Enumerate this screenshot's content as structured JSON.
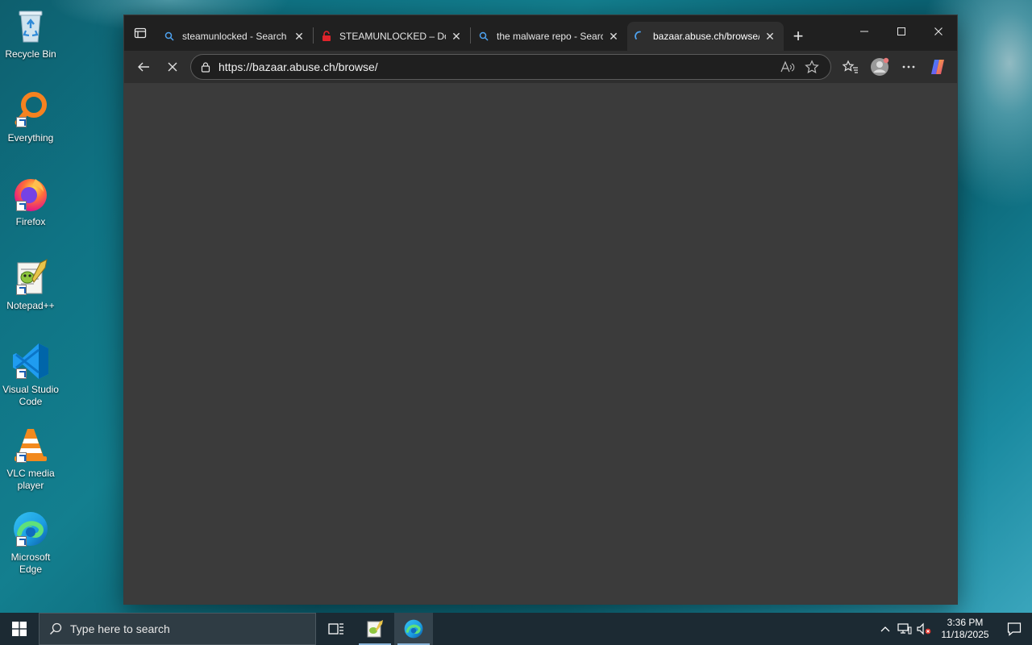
{
  "desktop": {
    "icons": [
      {
        "label": "Recycle Bin",
        "icon": "recycle-bin-icon"
      },
      {
        "label": "Everything",
        "icon": "everything-search-icon"
      },
      {
        "label": "Firefox",
        "icon": "firefox-icon"
      },
      {
        "label": "Notepad++",
        "icon": "notepadpp-icon"
      },
      {
        "label": "Visual Studio Code",
        "icon": "vscode-icon"
      },
      {
        "label": "VLC media player",
        "icon": "vlc-icon"
      },
      {
        "label": "Microsoft Edge",
        "icon": "edge-icon"
      }
    ]
  },
  "browser": {
    "tabs": [
      {
        "title": "steamunlocked - Search",
        "favicon": "search-icon",
        "active": false
      },
      {
        "title": "STEAMUNLOCKED – Dow",
        "favicon": "steamunlocked-icon",
        "active": false
      },
      {
        "title": "the malware repo - Searc",
        "favicon": "search-icon",
        "active": false
      },
      {
        "title": "bazaar.abuse.ch/browse/",
        "favicon": "loading-spinner-icon",
        "active": true
      }
    ],
    "address": {
      "url": "https://bazaar.abuse.ch/browse/"
    },
    "accent_color": "#0078d4",
    "content_background": "#3b3b3b"
  },
  "taskbar": {
    "search_placeholder": "Type here to search",
    "clock": {
      "time": "3:36 PM",
      "date": "11/18/2025"
    }
  }
}
